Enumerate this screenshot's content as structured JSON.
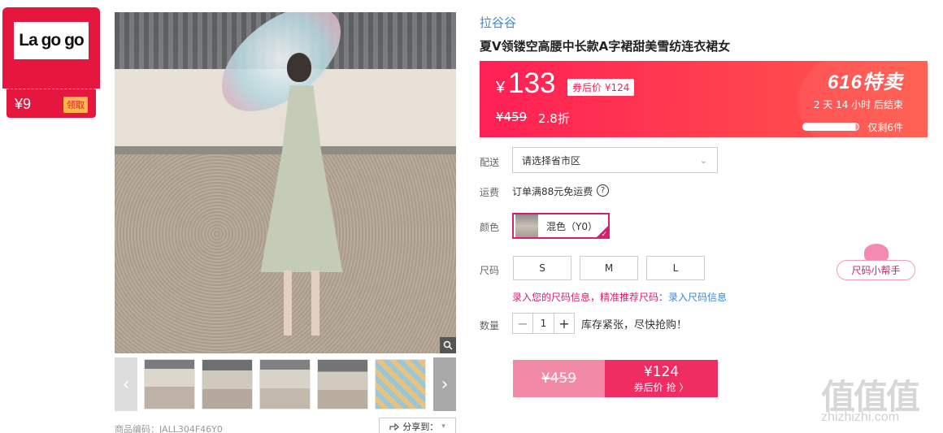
{
  "coupon": {
    "brand_logo": "La go go",
    "amount": "¥9",
    "get_label": "领取"
  },
  "gallery": {
    "zoom_icon": "magnifier-icon",
    "prev_icon": "chevron-left-icon",
    "next_icon": "chevron-right-icon",
    "product_code": "商品编码：JALL304F46Y0",
    "share_label": "分享到："
  },
  "product": {
    "brand": "拉谷谷",
    "title": "夏V领镂空高腰中长款A字裙甜美雪纺连衣裙女"
  },
  "promo": {
    "currency": "¥",
    "price": "133",
    "after_coupon": "券后价 ¥124",
    "original_price": "¥459",
    "discount": "2.8折",
    "sale_title": "616特卖",
    "countdown": "2 天 14 小时 后结束",
    "stock_text": "仅剩6件",
    "stock_fraction": 0.95,
    "gradient_start": "#ff1f55",
    "gradient_end": "#ff5a4a"
  },
  "delivery": {
    "label": "配送",
    "placeholder": "请选择省市区",
    "chevron_icon": "chevron-down-icon"
  },
  "shipping": {
    "label": "运费",
    "text": "订单满88元免运费",
    "help_icon": "question-icon"
  },
  "color": {
    "label": "颜色",
    "option": "混色（Y0）",
    "accent": "#d81e6f"
  },
  "size": {
    "label": "尺码",
    "options": [
      "S",
      "M",
      "L"
    ],
    "hint": "录入您的尺码信息，精准推荐尺码：",
    "hint_link": "录入尺码信息",
    "helper": "尺码小帮手"
  },
  "quantity": {
    "label": "数量",
    "minus": "−",
    "value": "1",
    "plus": "+",
    "note": "库存紧张，尽快抢购！"
  },
  "buy": {
    "original_price": "¥459",
    "price": "¥124",
    "action": "券后价 抢 〉"
  },
  "watermark": {
    "text": "值值值",
    "url": "zhizhizhi.com"
  }
}
